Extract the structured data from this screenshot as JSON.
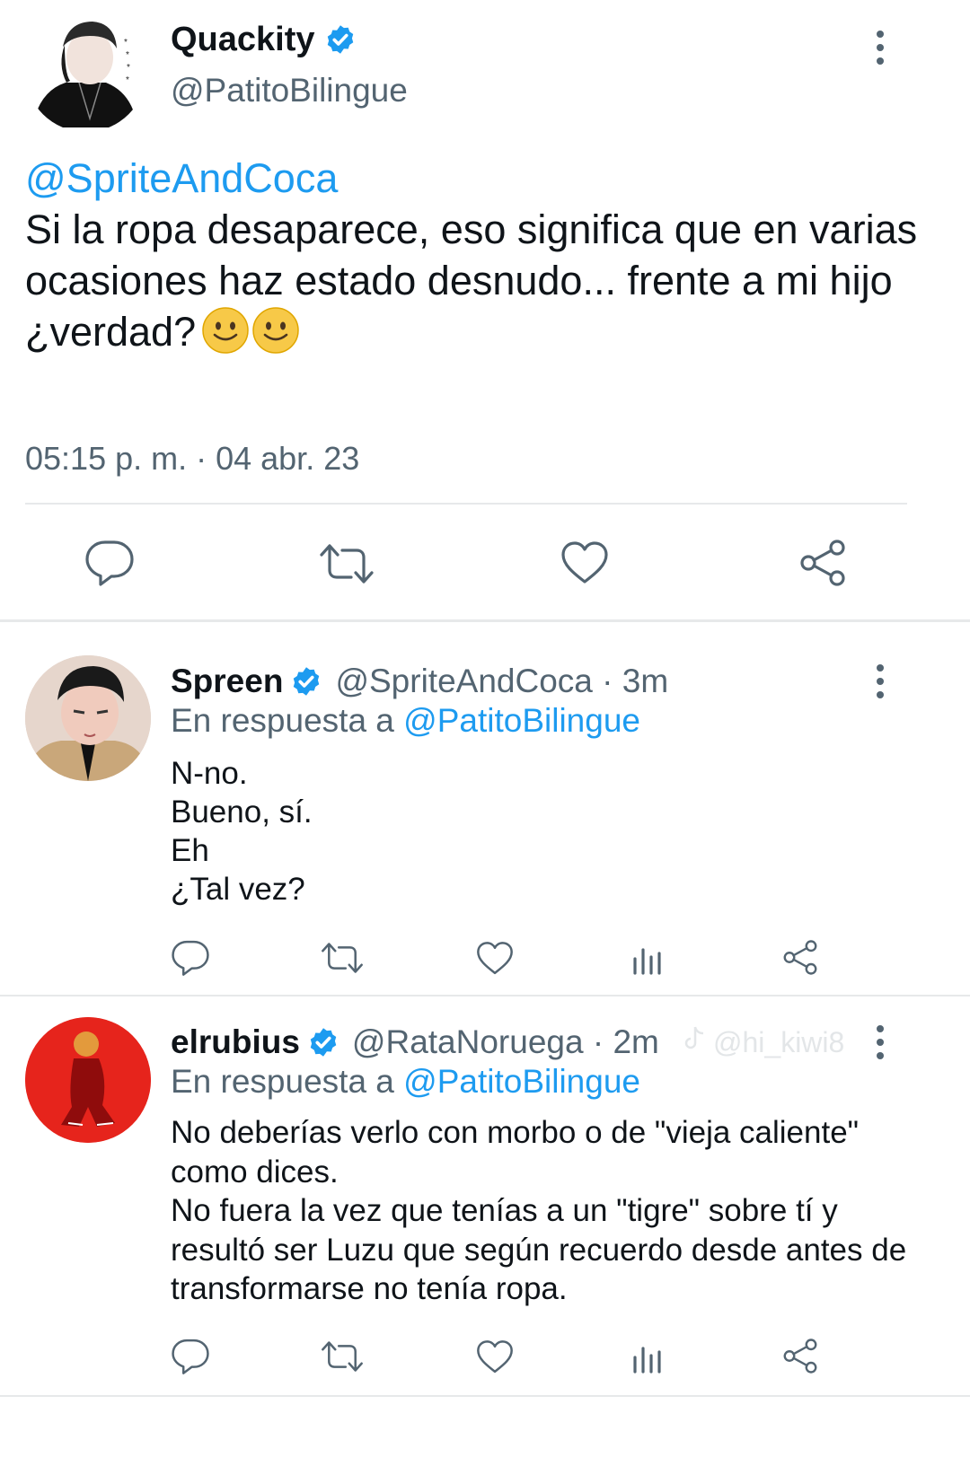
{
  "main_tweet": {
    "author_name": "Quackity",
    "author_handle": "@PatitoBilingue",
    "mention": "@SpriteAndCoca",
    "text": "Si la ropa desaparece, eso significa que en varias ocasiones haz estado desnudo... frente a mi hijo",
    "text_line2": "¿verdad?",
    "emojis": [
      "slightly-smiling-face",
      "slightly-smiling-face"
    ],
    "timestamp": "05:15 p. m. · 04 abr. 23",
    "actions": [
      "reply-icon",
      "retweet-icon",
      "like-icon",
      "share-icon"
    ]
  },
  "replies": [
    {
      "author_name": "Spreen",
      "author_handle": "@SpriteAndCoca · 3m",
      "in_reply_prefix": "En respuesta a",
      "in_reply_to": "@PatitoBilingue",
      "text": "N-no.\nBueno, sí.\nEh\n¿Tal vez?",
      "actions": [
        "reply-icon",
        "retweet-icon",
        "like-icon",
        "views-icon",
        "share-icon"
      ]
    },
    {
      "author_name": "elrubius",
      "author_handle": "@RataNoruega · 2m",
      "watermark": "@hi_kiwi8",
      "in_reply_prefix": "En respuesta a",
      "in_reply_to": "@PatitoBilingue",
      "text": "No deberías verlo con morbo o de \"vieja caliente\" como dices.\nNo fuera la vez que tenías a un \"tigre\" sobre tí y resultó ser Luzu que según recuerdo desde antes de transformarse no tenía ropa.",
      "actions": [
        "reply-icon",
        "retweet-icon",
        "like-icon",
        "views-icon",
        "share-icon"
      ]
    }
  ],
  "colors": {
    "link": "#1d9bf0",
    "verified": "#1d9bf0",
    "secondary_text": "#536471",
    "divider": "#e7e9ea"
  }
}
